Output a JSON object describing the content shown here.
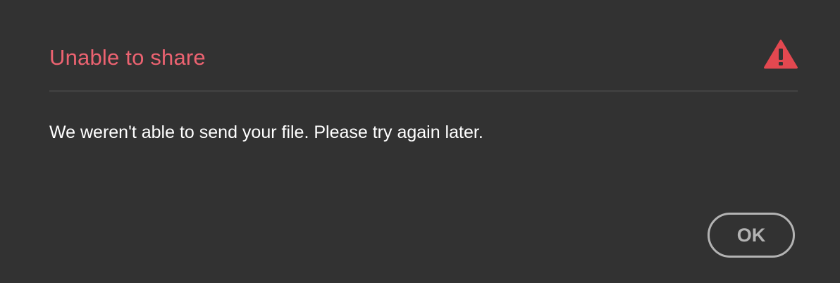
{
  "dialog": {
    "title": "Unable to share",
    "icon": "alert-triangle-icon",
    "message": "We weren't able to send your file. Please try again later.",
    "ok_label": "OK"
  },
  "colors": {
    "background": "#323232",
    "title": "#ec6371",
    "alert_icon": "#e34850",
    "message_text": "#ffffff",
    "button_border": "#b3b3b3",
    "divider": "#3f3f3f"
  }
}
